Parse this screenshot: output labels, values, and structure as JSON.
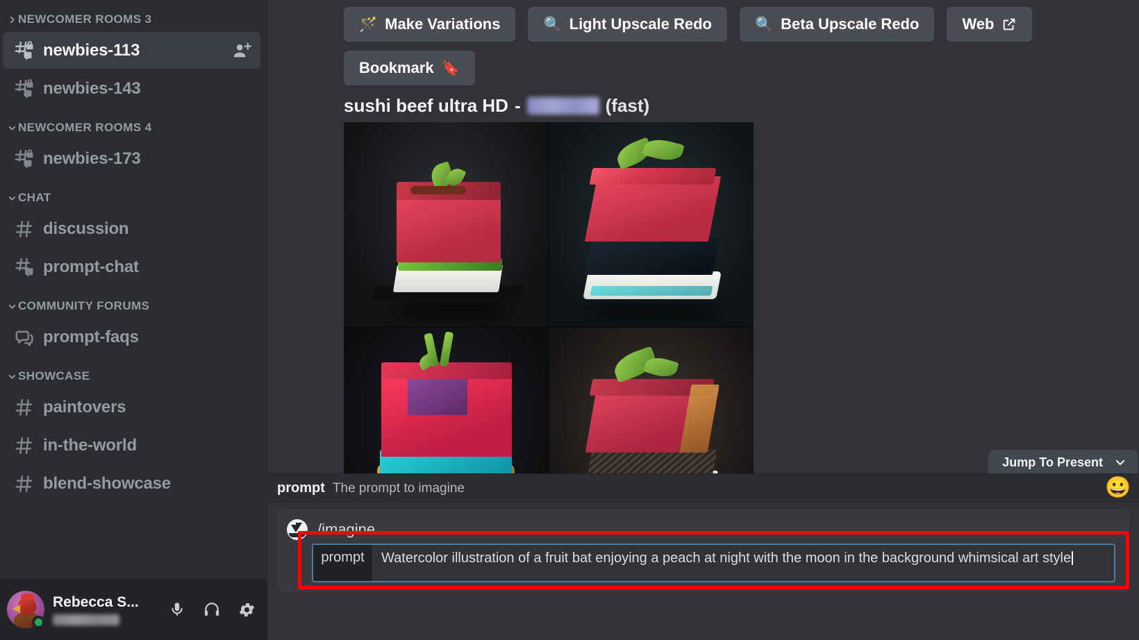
{
  "sidebar": {
    "sections": [
      {
        "label": "NEWCOMER ROOMS 3",
        "collapsed": true,
        "channels": [
          {
            "name": "newbies-113",
            "icon": "locked-thread-channel-icon",
            "active": true,
            "trailing_icon": "add-member-icon"
          },
          {
            "name": "newbies-143",
            "icon": "locked-thread-channel-icon",
            "active": false,
            "trailing_icon": ""
          }
        ]
      },
      {
        "label": "NEWCOMER ROOMS 4",
        "collapsed": false,
        "channels": [
          {
            "name": "newbies-173",
            "icon": "locked-thread-channel-icon",
            "active": false,
            "trailing_icon": ""
          }
        ]
      },
      {
        "label": "CHAT",
        "collapsed": false,
        "channels": [
          {
            "name": "discussion",
            "icon": "hash-channel-icon",
            "active": false,
            "trailing_icon": ""
          },
          {
            "name": "prompt-chat",
            "icon": "thread-channel-icon",
            "active": false,
            "trailing_icon": ""
          }
        ]
      },
      {
        "label": "COMMUNITY FORUMS",
        "collapsed": false,
        "channels": [
          {
            "name": "prompt-faqs",
            "icon": "forum-channel-icon",
            "active": false,
            "trailing_icon": ""
          }
        ]
      },
      {
        "label": "SHOWCASE",
        "collapsed": false,
        "channels": [
          {
            "name": "paintovers",
            "icon": "hash-channel-icon",
            "active": false,
            "trailing_icon": ""
          },
          {
            "name": "in-the-world",
            "icon": "hash-channel-icon",
            "active": false,
            "trailing_icon": ""
          },
          {
            "name": "blend-showcase",
            "icon": "hash-channel-icon",
            "active": false,
            "trailing_icon": ""
          }
        ]
      }
    ],
    "user_panel": {
      "display_name": "Rebecca S...",
      "status": "online",
      "status_color": "#23a55a",
      "mic_icon": "microphone-icon",
      "headset_icon": "headset-icon",
      "settings_icon": "gear-icon"
    }
  },
  "main": {
    "action_buttons": [
      {
        "label": "Make Variations",
        "emoji": "🪄",
        "icon_name": "magic-wand-icon"
      },
      {
        "label": "Light Upscale Redo",
        "emoji": "🔍",
        "icon_name": "magnifier-icon"
      },
      {
        "label": "Beta Upscale Redo",
        "emoji": "🔍",
        "icon_name": "magnifier-icon"
      },
      {
        "label": "Web",
        "emoji": "",
        "icon_name": "external-link-icon"
      },
      {
        "label": "Bookmark",
        "emoji": "🔖",
        "icon_name": "bookmark-icon"
      }
    ],
    "message": {
      "prompt_text": "sushi beef ultra HD",
      "separator": "-",
      "mention_redacted": true,
      "speed_label": "(fast)",
      "image_grid": {
        "columns": 2,
        "rows": 2,
        "cells": [
          {
            "position": "top-left",
            "subject": "tuna cube sushi with rice and herbs on dark slate"
          },
          {
            "position": "top-right",
            "subject": "tuna block with nori and basil leaves on rice"
          },
          {
            "position": "bottom-left",
            "subject": "magenta tuna cube with chives and teal accents"
          },
          {
            "position": "bottom-right",
            "subject": "seared beef block with basil leaf and seed crust"
          }
        ]
      }
    },
    "jump_to_present": {
      "label": "Jump To Present",
      "icon_name": "chevron-down-icon"
    }
  },
  "command_bar": {
    "hint": {
      "option_name": "prompt",
      "option_description": "The prompt to imagine"
    },
    "command_name": "/imagine",
    "bot_avatar_icon": "sailboat-avatar-icon",
    "field": {
      "chip_label": "prompt",
      "value": "Watercolor illustration of a fruit bat enjoying a peach at night with the moon in the background whimsical art style",
      "focused": true
    },
    "emoji_picker_icon": "😀",
    "highlight_color": "#ff0000"
  }
}
